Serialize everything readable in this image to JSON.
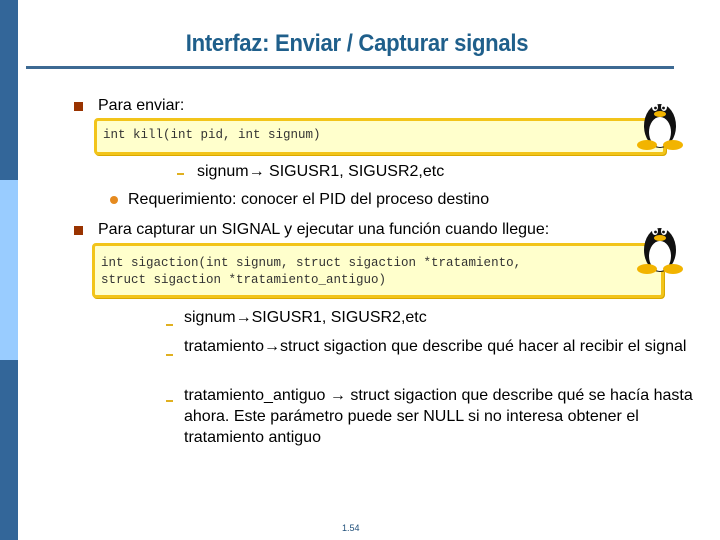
{
  "slide": {
    "title": "Interfaz: Enviar / Capturar signals",
    "page_number": "1.54",
    "colors": {
      "sidebar_dark": "#336699",
      "sidebar_light": "#99ccff",
      "title": "#1f5f8b",
      "bullet_square": "#993300",
      "bullet_dot": "#e58a1f",
      "code_bg": "#ffffcc",
      "code_border": "#f2c41a"
    }
  },
  "section_send": {
    "heading": "Para enviar:",
    "code": [
      "int kill(int pid, int signum)"
    ],
    "sub_items": [
      "signum→ SIGUSR1, SIGUSR2,etc"
    ],
    "requirement": "Requerimiento: conocer el PID del proceso destino",
    "icon": "tux-penguin-icon"
  },
  "section_capture": {
    "heading": "Para capturar un SIGNAL y ejecutar una función cuando llegue:",
    "code": [
      "int sigaction(int signum, struct sigaction *tratamiento,",
      "struct sigaction *tratamiento_antiguo)"
    ],
    "sub_items": [
      "signum→SIGUSR1, SIGUSR2,etc",
      "tratamiento→struct sigaction que describe qué hacer al recibir el signal",
      "tratamiento_antiguo → struct sigaction que describe qué se hacía hasta ahora. Este parámetro puede ser NULL si no interesa obtener el tratamiento antiguo"
    ],
    "icon": "tux-penguin-icon"
  }
}
